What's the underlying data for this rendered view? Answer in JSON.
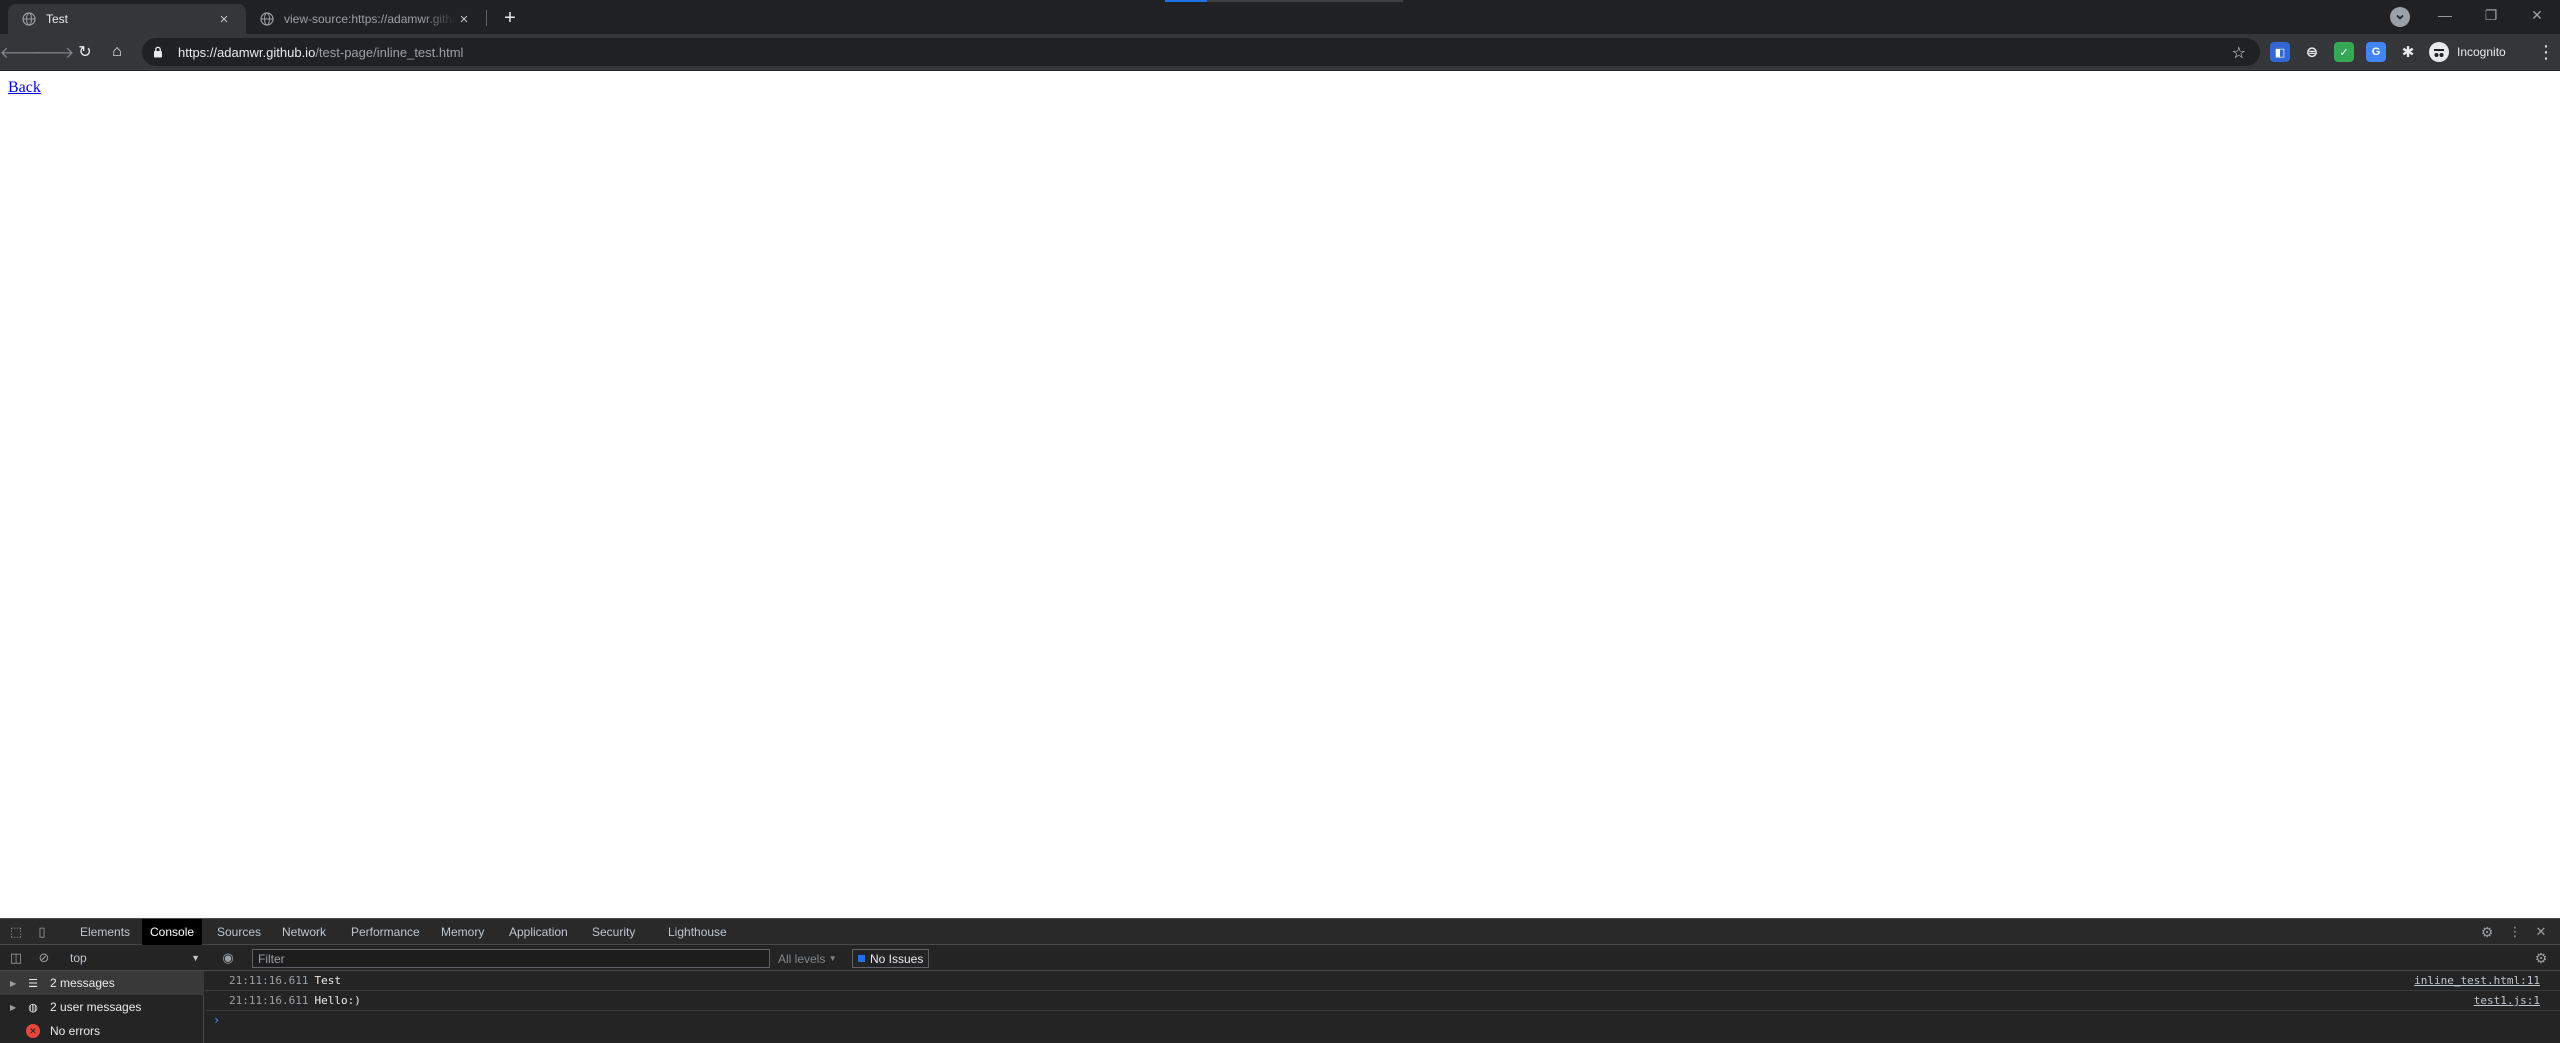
{
  "browser": {
    "tabs": [
      {
        "title": "Test",
        "active": true
      },
      {
        "title": "view-source:https://adamwr.github.io/test-page/inline_test.html",
        "active": false
      }
    ],
    "address": {
      "host": "https://adamwr.github.io",
      "path": "/test-page/inline_test.html"
    },
    "profile_label": "Incognito"
  },
  "page": {
    "back_link": "Back"
  },
  "devtools": {
    "tabs": [
      "Elements",
      "Console",
      "Sources",
      "Network",
      "Performance",
      "Memory",
      "Application",
      "Security",
      "Lighthouse"
    ],
    "active_tab": "Console",
    "context": "top",
    "filter_placeholder": "Filter",
    "levels": "All levels",
    "issues": "No Issues",
    "sidebar": [
      {
        "label": "2 messages",
        "icon": "list-icon"
      },
      {
        "label": "2 user messages",
        "icon": "user-icon"
      },
      {
        "label": "No errors",
        "icon": "error-icon"
      }
    ],
    "messages": [
      {
        "time": "21:11:16.611",
        "text": "Test",
        "source": "inline_test.html:11"
      },
      {
        "time": "21:11:16.611",
        "text": "Hello:)",
        "source": "test1.js:1"
      }
    ]
  },
  "colors": {
    "accent": "#1a73e8",
    "link": "#0000ee",
    "chrome_dark": "#202124",
    "devtools_bg": "#242424"
  }
}
